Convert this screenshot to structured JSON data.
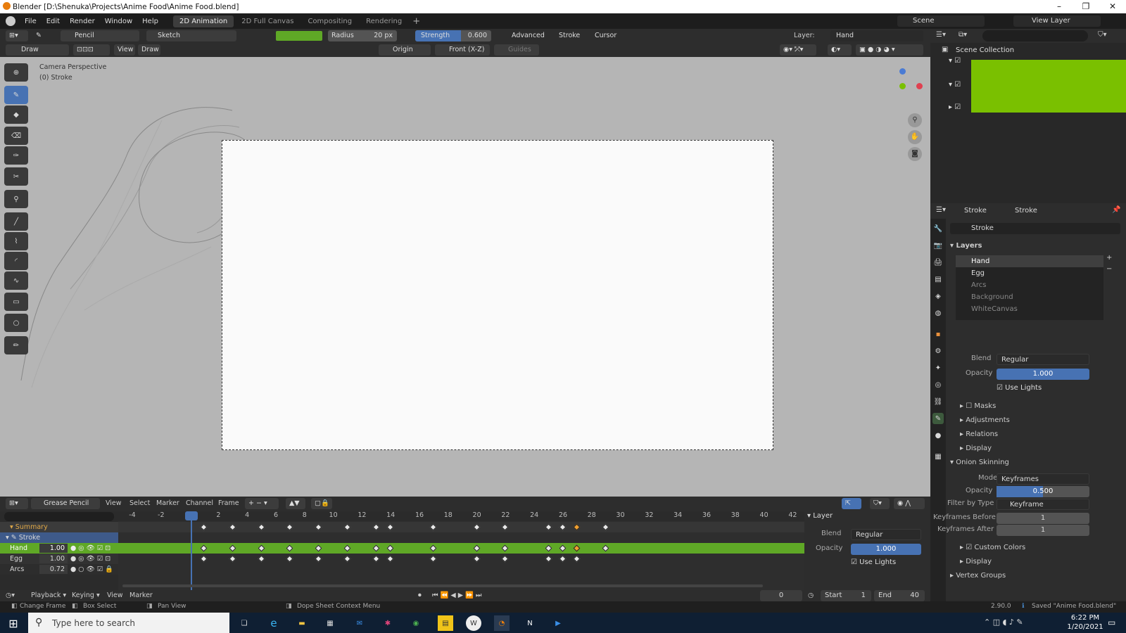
{
  "window": {
    "title": "Blender [D:\\Shenuka\\Projects\\Anime Food\\Anime Food.blend]"
  },
  "menu": [
    "File",
    "Edit",
    "Render",
    "Window",
    "Help"
  ],
  "workspaces": [
    "2D Animation",
    "2D Full Canvas",
    "Compositing",
    "Rendering"
  ],
  "topright": {
    "scene": "Scene",
    "view_layer": "View Layer"
  },
  "tool_header": {
    "brush": "Pencil",
    "material": "Sketch",
    "radius_label": "Radius",
    "radius_value": "20 px",
    "strength_label": "Strength",
    "strength_value": "0.600",
    "advanced": "Advanced",
    "stroke": "Stroke",
    "cursor": "Cursor",
    "layer_label": "Layer:",
    "layer_value": "Hand"
  },
  "sub_header": {
    "mode": "Draw",
    "view": "View",
    "draw": "Draw",
    "origin": "Origin",
    "front": "Front (X-Z)",
    "guides": "Guides"
  },
  "viewport": {
    "line1": "Camera Perspective",
    "line2": "(0) Stroke"
  },
  "outliner": {
    "title": "Scene Collection"
  },
  "properties": {
    "header_object": "Stroke",
    "header_data": "Stroke",
    "datablock": "Stroke",
    "layers_title": "Layers",
    "layers": [
      "Hand",
      "Egg",
      "Arcs",
      "Background",
      "WhiteCanvas"
    ],
    "blend_label": "Blend",
    "blend_value": "Regular",
    "opacity_label": "Opacity",
    "opacity_value": "1.000",
    "opacity_fill": 1.0,
    "use_lights": "Use Lights",
    "masks": "Masks",
    "adjustments": "Adjustments",
    "relations": "Relations",
    "display": "Display",
    "onion_title": "Onion Skinning",
    "mode_label": "Mode",
    "mode_value": "Keyframes",
    "onion_opacity_label": "Opacity",
    "onion_opacity_value": "0.500",
    "onion_opacity_fill": 0.5,
    "filter_label": "Filter by Type",
    "filter_value": "Keyframe",
    "kf_before_label": "Keyframes Before",
    "kf_before_value": "1",
    "kf_after_label": "Keyframes After",
    "kf_after_value": "1",
    "custom_colors": "Custom Colors",
    "display2": "Display",
    "vertex_groups": "Vertex Groups"
  },
  "dopesheet": {
    "mode": "Grease Pencil",
    "menus": [
      "View",
      "Select",
      "Marker",
      "Channel",
      "Frame"
    ],
    "ticks": [
      "-4",
      "-2",
      "0",
      "2",
      "4",
      "6",
      "8",
      "10",
      "12",
      "14",
      "16",
      "18",
      "20",
      "22",
      "24",
      "26",
      "28",
      "30",
      "32",
      "34",
      "36",
      "38",
      "40",
      "42"
    ],
    "channels": {
      "summary": "Summary",
      "stroke": "Stroke",
      "hand": "Hand",
      "hand_val": "1.00",
      "egg": "Egg",
      "egg_val": "1.00",
      "arcs": "Arcs",
      "arcs_val": "0.72"
    },
    "side": {
      "layer": "Layer",
      "blend_label": "Blend",
      "blend_value": "Regular",
      "opacity_label": "Opacity",
      "opacity_value": "1.000",
      "use_lights": "Use Lights"
    }
  },
  "timeline": {
    "playback": "Playback",
    "keying": "Keying",
    "view": "View",
    "marker": "Marker",
    "current_frame": "0",
    "start_label": "Start",
    "start_value": "1",
    "end_label": "End",
    "end_value": "40"
  },
  "status": {
    "change_frame": "Change Frame",
    "box_select": "Box Select",
    "pan_view": "Pan View",
    "context_menu": "Dope Sheet Context Menu",
    "version": "2.90.0",
    "saved": "Saved \"Anime Food.blend\""
  },
  "taskbar": {
    "search_placeholder": "Type here to search",
    "time": "6:22 PM",
    "date": "1/20/2021"
  },
  "colors": {
    "accent": "#4772b3",
    "keyframe_selected": "#f0a030",
    "channel_green": "#5fa826",
    "outliner_green": "#7ac000"
  }
}
